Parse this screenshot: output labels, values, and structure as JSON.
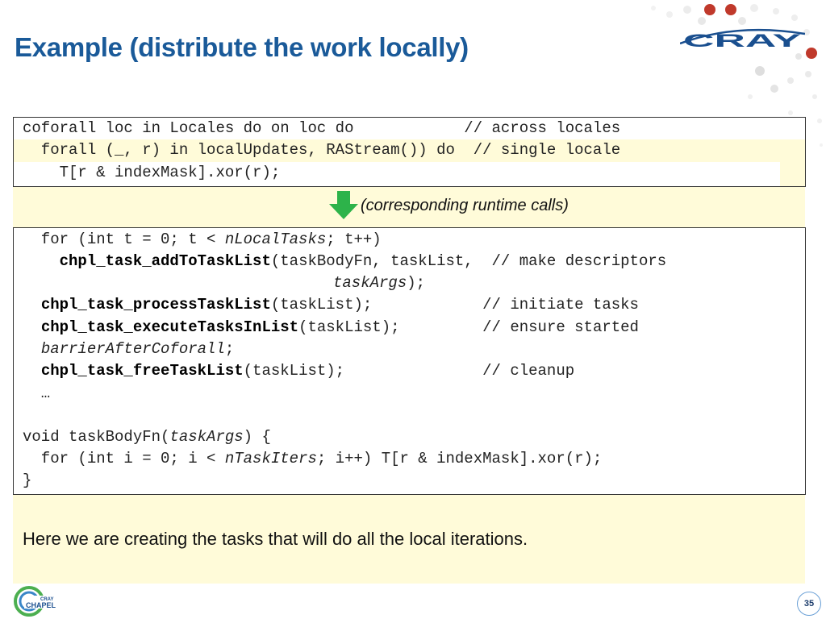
{
  "slide": {
    "title": "Example (distribute the work locally)",
    "runtime_label": "(corresponding runtime calls)",
    "summary": "Here we are creating the tasks that will do all the local iterations.",
    "page_number": "35"
  },
  "logos": {
    "cray": "CRAY",
    "chapel_top": "CRAY",
    "chapel_bottom": "CHAPEL"
  },
  "colors": {
    "title": "#1a5a99",
    "highlight": "#fffbd9",
    "arrow": "#2db34a",
    "cray": "#1a4f8f"
  },
  "code_top": {
    "l1": {
      "code": "coforall loc in Locales do on loc do            ",
      "comment": "// across locales"
    },
    "l2": {
      "code": "  forall (_, r) in localUpdates, RAStream()) do  ",
      "comment": "// single locale"
    },
    "l3": {
      "code": "    T[r & indexMask].xor(r);"
    }
  },
  "code_bottom": {
    "l1": {
      "a": "  for (int t = 0; t < ",
      "b": "nLocalTasks",
      "c": "; t++)"
    },
    "l2": {
      "a": "    ",
      "b": "chpl_task_addToTaskList",
      "c": "(taskBodyFn, taskList,  ",
      "d": "// make descriptors"
    },
    "l3": {
      "a": "                        ",
      "b": "taskArgs",
      "c": ");"
    },
    "l4": {
      "a": "  ",
      "b": "chpl_task_processTaskList",
      "c": "(taskList);            ",
      "d": "// initiate tasks"
    },
    "l5": {
      "a": "  ",
      "b": "chpl_task_executeTasksInList",
      "c": "(taskList);         ",
      "d": "// ensure started"
    },
    "l6": {
      "a": "  ",
      "b": "barrierAfterCoforall",
      "c": ";"
    },
    "l7": {
      "a": "  ",
      "b": "chpl_task_freeTaskList",
      "c": "(taskList);               ",
      "d": "// cleanup"
    },
    "l8": {
      "a": "  …"
    },
    "l9": {
      "a": "void taskBodyFn(",
      "b": "taskArgs",
      "c": ") {"
    },
    "l10": {
      "a": "  for (int i = 0; i < ",
      "b": "nTaskIters",
      "c": "; i++) T[r & indexMask].xor(r);"
    },
    "l11": {
      "a": "}"
    }
  }
}
